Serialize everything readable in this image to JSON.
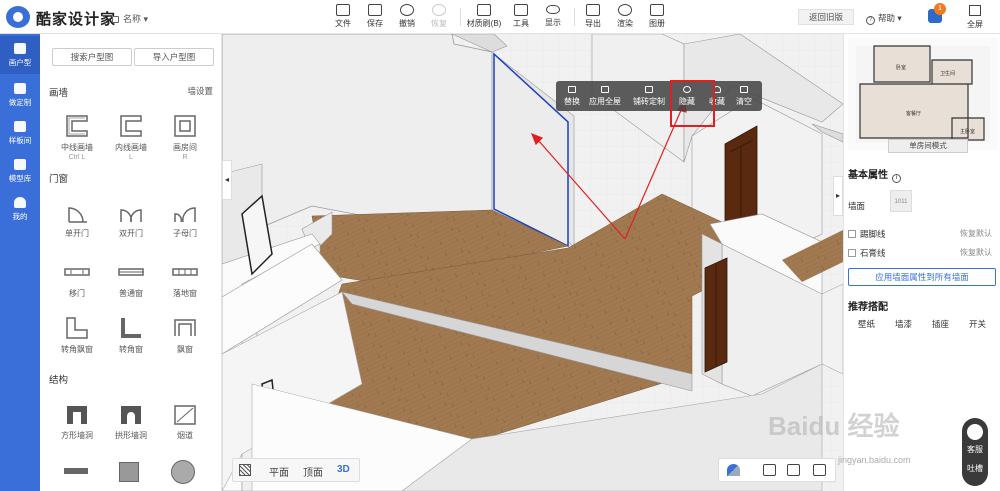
{
  "app": {
    "name": "酷家设计家",
    "project_name": "名称"
  },
  "toolbar": {
    "items": [
      {
        "label": "文件"
      },
      {
        "label": "保存"
      },
      {
        "label": "撤销"
      },
      {
        "label": "恢复"
      },
      {
        "label": "材质刷(B)"
      },
      {
        "label": "工具"
      },
      {
        "label": "显示"
      },
      {
        "label": "导出"
      },
      {
        "label": "渲染"
      },
      {
        "label": "图册"
      }
    ],
    "back_old": "返回旧版",
    "help": "帮助",
    "message_count": "1",
    "fullscreen": "全屏"
  },
  "leftnav": [
    {
      "label": "画户型",
      "icon": "floorplan-icon"
    },
    {
      "label": "做定制",
      "icon": "tools-icon"
    },
    {
      "label": "样板间",
      "icon": "sample-icon"
    },
    {
      "label": "模型库",
      "icon": "box-icon"
    },
    {
      "label": "我的",
      "icon": "user-icon"
    }
  ],
  "leftpanel": {
    "search_btn": "搜索户型图",
    "import_btn": "导入户型图",
    "wall_section": "画墙",
    "wall_settings": "墙设置",
    "walls": [
      {
        "label": "中线画墙",
        "sub": "Ctrl L"
      },
      {
        "label": "内线画墙",
        "sub": "L"
      },
      {
        "label": "画房间",
        "sub": "R"
      }
    ],
    "door_section": "门窗",
    "doors": [
      {
        "label": "单开门"
      },
      {
        "label": "双开门"
      },
      {
        "label": "子母门"
      },
      {
        "label": "移门"
      },
      {
        "label": "普通窗"
      },
      {
        "label": "落地窗"
      },
      {
        "label": "转角飘窗"
      },
      {
        "label": "转角窗"
      },
      {
        "label": "飘窗"
      }
    ],
    "struct_section": "结构",
    "structs": [
      {
        "label": "方形墙洞"
      },
      {
        "label": "拱形墙洞"
      },
      {
        "label": "烟道"
      }
    ]
  },
  "context_menu": [
    {
      "label": "替换"
    },
    {
      "label": "应用全屋"
    },
    {
      "label": "铺砖定制"
    },
    {
      "label": "隐藏"
    },
    {
      "label": "收藏"
    },
    {
      "label": "清空"
    }
  ],
  "view_tabs": {
    "plan": "平面",
    "top": "顶面",
    "3d": "3D"
  },
  "rightpanel": {
    "minimap": {
      "rooms": [
        "卧室",
        "卫生间",
        "客餐厅",
        "主卧室"
      ],
      "mode_btn": "单房间模式"
    },
    "basic_title": "基本属性",
    "wall_label": "墙面",
    "wall_code": "1011",
    "skirting": "踢脚线",
    "plaster": "石膏线",
    "reset": "恢复默认",
    "apply_all": "应用墙面属性到所有墙面",
    "rec_title": "推荐搭配",
    "rec_tabs": [
      "壁纸",
      "墙漆",
      "插座",
      "开关"
    ]
  },
  "watermark": {
    "text": "Baidu 经验",
    "url": "jingyan.baidu.com"
  },
  "service": {
    "line1": "客服",
    "line2": "吐槽"
  },
  "colors": {
    "brand": "#3a6fd9",
    "highlight": "#e02020",
    "floor": "#a27a52"
  }
}
